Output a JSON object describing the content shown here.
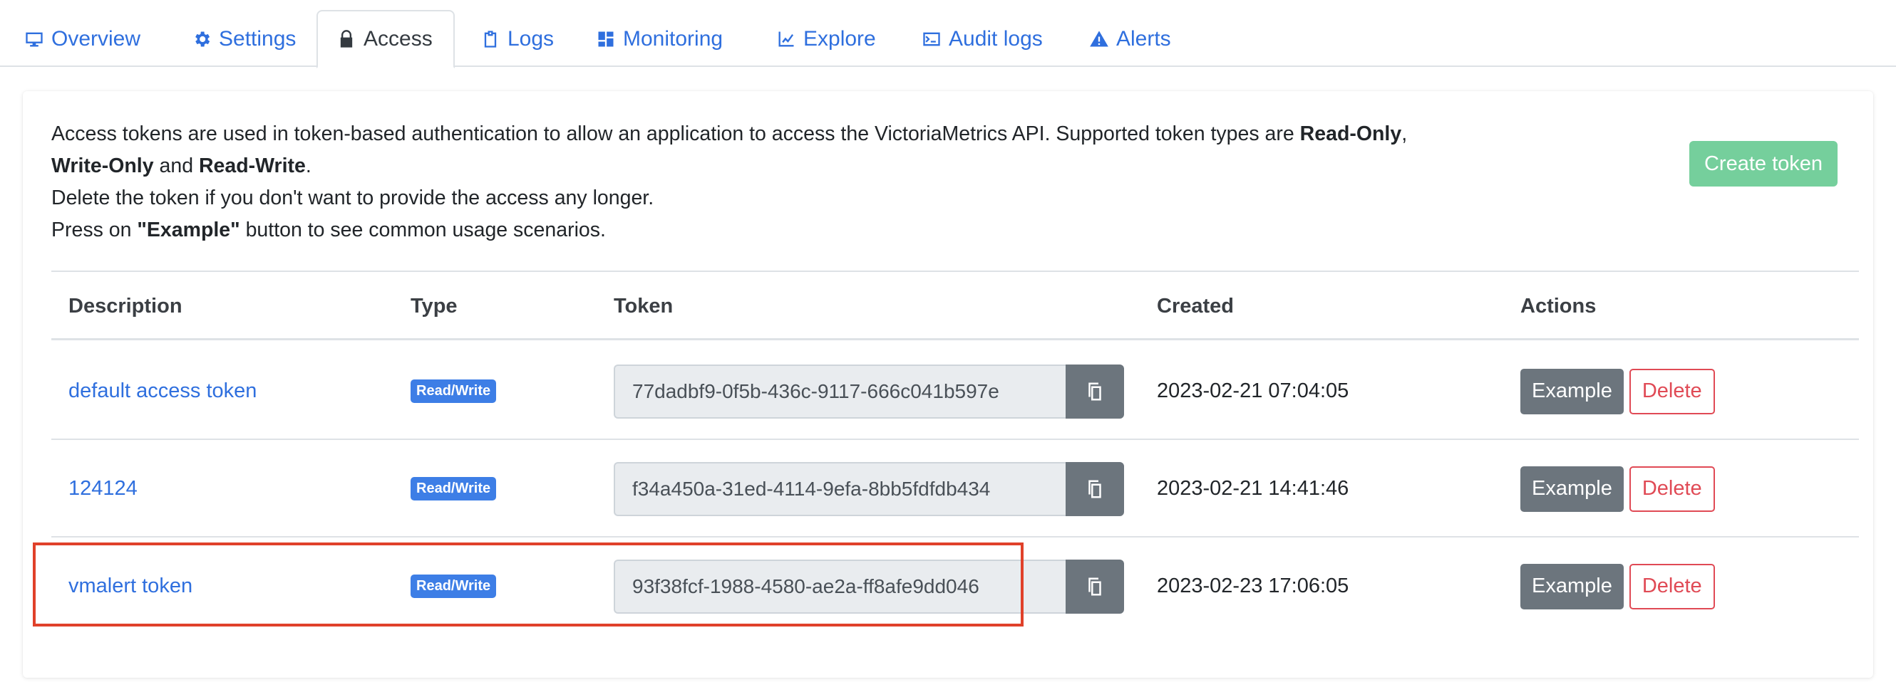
{
  "tabs": [
    {
      "label": "Overview",
      "icon": "monitor-icon"
    },
    {
      "label": "Settings",
      "icon": "gear-icon"
    },
    {
      "label": "Access",
      "icon": "lock-icon",
      "active": true
    },
    {
      "label": "Logs",
      "icon": "clipboard-icon"
    },
    {
      "label": "Monitoring",
      "icon": "dashboard-icon"
    },
    {
      "label": "Explore",
      "icon": "chart-line-icon"
    },
    {
      "label": "Audit logs",
      "icon": "terminal-icon"
    },
    {
      "label": "Alerts",
      "icon": "warning-icon"
    }
  ],
  "intro": {
    "line1_a": "Access tokens are used in token-based authentication to allow an application to access the VictoriaMetrics API. Supported token types are ",
    "line1_b": "Read-Only",
    "line1_c": ",",
    "line2_a": "Write-Only",
    "line2_b": " and ",
    "line2_c": "Read-Write",
    "line2_d": ".",
    "line3": "Delete the token if you don't want to provide the access any longer.",
    "line4_a": "Press on ",
    "line4_b": "\"Example\"",
    "line4_c": " button to see common usage scenarios."
  },
  "create_button": "Create token",
  "table": {
    "headers": {
      "description": "Description",
      "type": "Type",
      "token": "Token",
      "created": "Created",
      "actions": "Actions"
    },
    "rows": [
      {
        "description": "default access token",
        "type": "Read/Write",
        "token": "77dadbf9-0f5b-436c-9117-666c041b597e",
        "created": "2023-02-21 07:04:05",
        "example": "Example",
        "delete": "Delete"
      },
      {
        "description": "124124",
        "type": "Read/Write",
        "token": "f34a450a-31ed-4114-9efa-8bb5fdfdb434",
        "created": "2023-02-21 14:41:46",
        "example": "Example",
        "delete": "Delete"
      },
      {
        "description": "vmalert token",
        "type": "Read/Write",
        "token": "93f38fcf-1988-4580-ae2a-ff8afe9dd046",
        "created": "2023-02-23 17:06:05",
        "example": "Example",
        "delete": "Delete"
      }
    ]
  },
  "colors": {
    "link": "#2f6fde",
    "create_button": "#75cf9c",
    "badge": "#3d7ee6",
    "secondary": "#6c757d",
    "danger": "#e04a55",
    "highlight": "#e0412a"
  }
}
